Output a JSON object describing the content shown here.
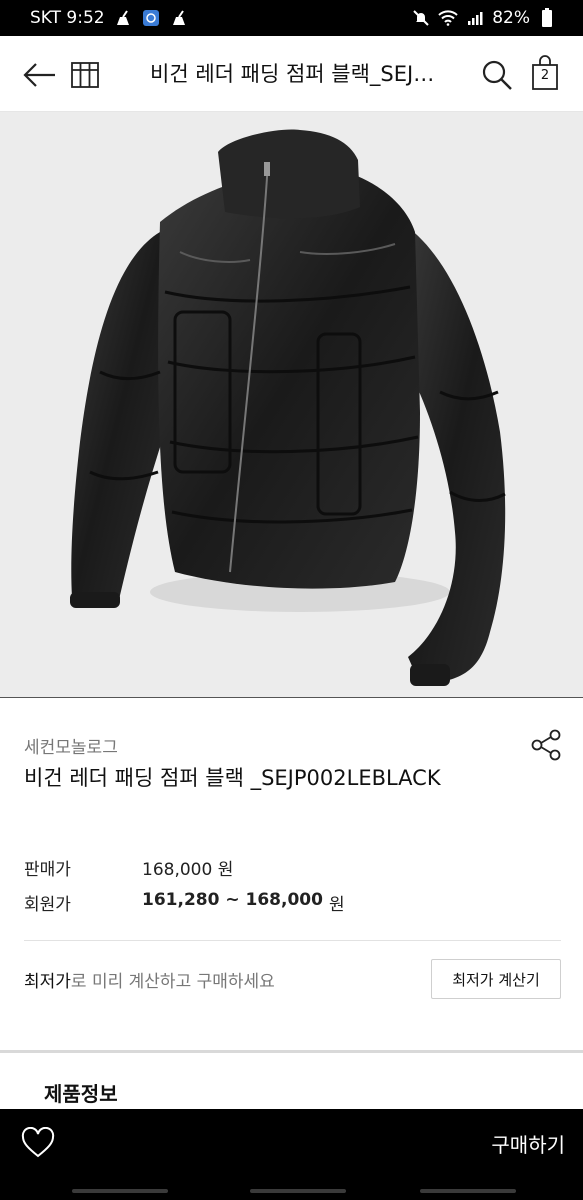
{
  "status_bar": {
    "carrier_time": "SKT 9:52",
    "battery": "82%"
  },
  "header": {
    "title": "비건 레더 패딩 점퍼 블랙_SEJP002LEBLACK",
    "cart_count": "2"
  },
  "product": {
    "brand": "세컨모놀로그",
    "name": "비건 레더 패딩 점퍼 블랙 _SEJP002LEBLACK",
    "sale_price_label": "판매가",
    "sale_price": "168,000 원",
    "member_price_label": "회원가",
    "member_price": "161,280 ~ 168,000",
    "member_price_unit": "원"
  },
  "calc": {
    "lead": "최저가",
    "rest": "로 미리 계산하고 구매하세요",
    "button_label": "최저가 계산기"
  },
  "section": {
    "title": "제품정보"
  },
  "bottom_bar": {
    "buy_label": "구매하기"
  },
  "icons": [
    "back-arrow-icon",
    "home-icon",
    "search-icon",
    "shopping-bag-icon",
    "share-icon",
    "heart-icon",
    "mute-icon",
    "wifi-icon",
    "signal-icon",
    "battery-icon"
  ]
}
